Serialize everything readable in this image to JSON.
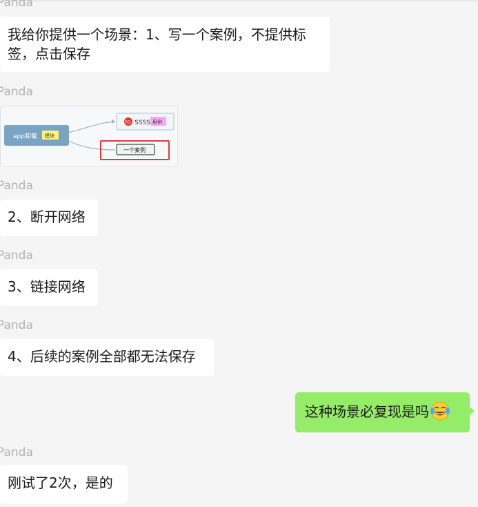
{
  "chat": {
    "messages": [
      {
        "sender": "Panda",
        "type": "text",
        "text": "我给你提供一个场景：1、写一个案例，不提供标签，点击保存"
      },
      {
        "sender": "Panda",
        "type": "image",
        "mindmap": {
          "root_label": "app卸载",
          "root_tag": "模块",
          "child1_icon": "PD",
          "child1_label": "SSSS",
          "child1_tag": "用例",
          "child2_label": "一个案例"
        }
      },
      {
        "sender": "Panda",
        "type": "text",
        "text": "2、断开网络"
      },
      {
        "sender": "Panda",
        "type": "text",
        "text": "3、链接网络"
      },
      {
        "sender": "Panda",
        "type": "text",
        "text": "4、后续的案例全部都无法保存"
      },
      {
        "sender": "me",
        "type": "text",
        "text": "这种场景必复现是吗",
        "emoji": "tears-of-joy-emoji"
      },
      {
        "sender": "Panda",
        "type": "text",
        "text": "刚试了2次，是的"
      }
    ]
  },
  "colors": {
    "background": "#f5f5f5",
    "incoming_bubble": "#ffffff",
    "outgoing_bubble": "#95ec69",
    "sender_name": "#b2b2b2",
    "mindmap_root": "#7ba3c4",
    "mindmap_highlight": "#e03b3b"
  }
}
